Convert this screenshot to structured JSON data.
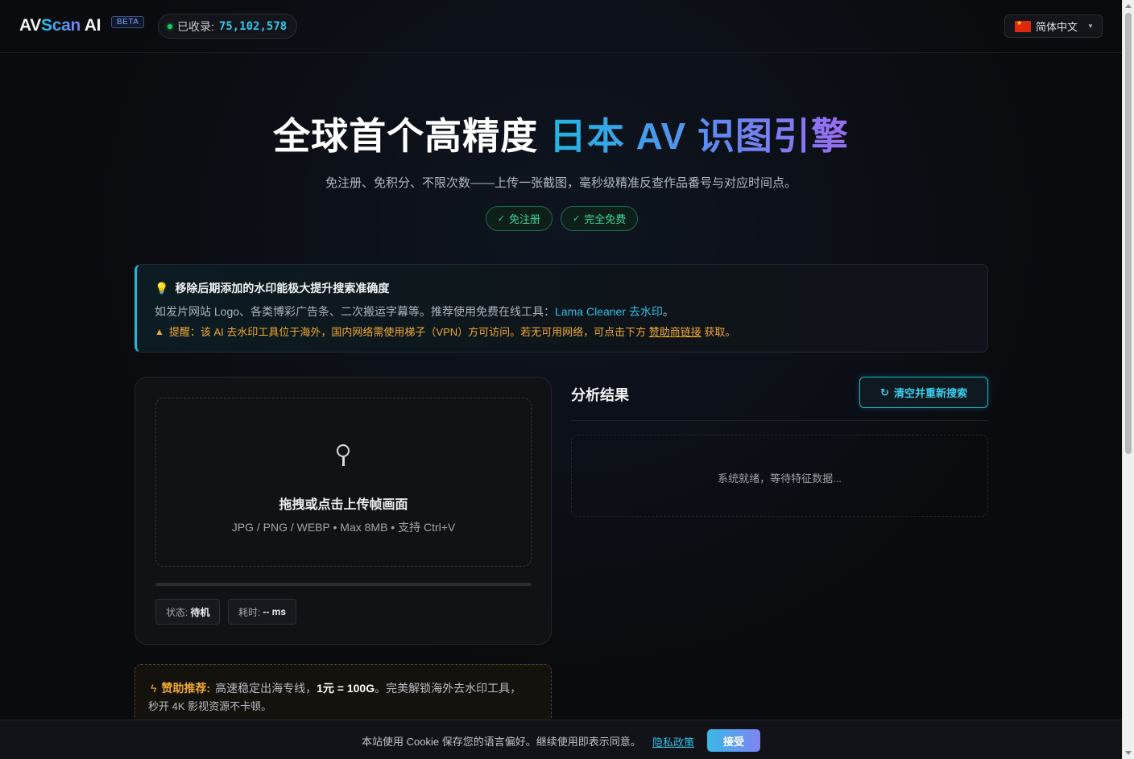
{
  "header": {
    "logo_av": "AV",
    "logo_scan": "Scan",
    "logo_ai": " AI",
    "beta": "BETA",
    "count_label": "已收录:",
    "count_value": "75,102,578",
    "lang_label": "简体中文"
  },
  "hero": {
    "title_white": "全球首个高精度 ",
    "title_gradient": "日本 AV 识图引擎",
    "subtitle": "免注册、免积分、不限次数——上传一张截图，毫秒级精准反查作品番号与对应时间点。",
    "tags": [
      "免注册",
      "完全免费"
    ]
  },
  "notice": {
    "title": "移除后期添加的水印能极大提升搜索准确度",
    "desc": "如发片网站 Logo、各类博彩广告条、二次搬运字幕等。推荐使用免费在线工具：",
    "link": "Lama Cleaner 去水印",
    "desc_end": "。",
    "warn_prefix": "提醒：该 AI 去水印工具位于海外，国内网络需使用梯子（VPN）方可访问。若无可用网络，可点击下方",
    "warn_link": "赞助商链接",
    "warn_suffix": "获取。"
  },
  "upload": {
    "title": "拖拽或点击上传帧画面",
    "subtitle": "JPG / PNG / WEBP • Max 8MB • 支持 Ctrl+V",
    "progress": 0,
    "status_label": "状态:",
    "status_value": "待机",
    "time_label": "耗时:",
    "time_value": "-- ms"
  },
  "results": {
    "title": "分析结果",
    "reset_label": "清空并重新搜索",
    "empty_message": "系统就绪，等待特征数据..."
  },
  "sponsor": {
    "label": "赞助推荐:",
    "text1": "高速稳定出海专线，",
    "highlight": "1元 = 100G",
    "text2": "。完美解锁海外去水印工具，",
    "line2": "秒开 4K 影视资源不卡顿。"
  },
  "cookie": {
    "text": "本站使用 Cookie 保存您的语言偏好。继续使用即表示同意。",
    "privacy": "隐私政策",
    "accept": "接受"
  },
  "colors": {
    "accent": "#23b6d8",
    "success": "#3ed49a",
    "warning": "#f0a934"
  }
}
